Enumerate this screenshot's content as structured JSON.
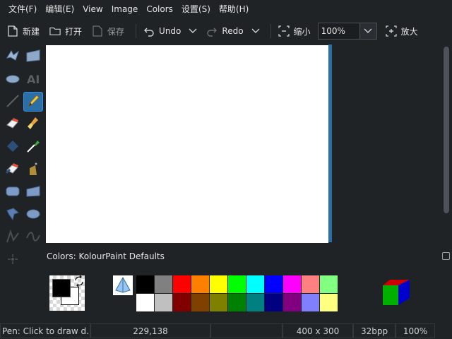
{
  "menu": [
    "文件(F)",
    "编辑(E)",
    "View",
    "Image",
    "Colors",
    "设置(S)",
    "帮助(H)"
  ],
  "toolbar": {
    "new_label": "新建",
    "open_label": "打开",
    "save_label": "保存",
    "undo_label": "Undo",
    "redo_label": "Redo",
    "zoom_out_label": "缩小",
    "zoom_value": "100%",
    "zoom_in_label": "放大"
  },
  "tools": [
    {
      "name": "free-form-select-tool",
      "icon": "lasso-icon",
      "active": false
    },
    {
      "name": "rectangular-select-tool",
      "icon": "rect-select-icon",
      "active": false
    },
    {
      "name": "elliptical-select-tool",
      "icon": "ellipse-select-icon",
      "active": false
    },
    {
      "name": "text-tool",
      "icon": "text-icon",
      "active": false
    },
    {
      "name": "line-tool",
      "icon": "line-icon",
      "active": false
    },
    {
      "name": "pen-tool",
      "icon": "pencil-icon",
      "active": true
    },
    {
      "name": "eraser-tool",
      "icon": "eraser-icon",
      "active": false
    },
    {
      "name": "brush-tool",
      "icon": "brush-icon",
      "active": false
    },
    {
      "name": "flood-fill-tool",
      "icon": "paint-bucket-icon",
      "active": false
    },
    {
      "name": "color-picker-tool",
      "icon": "eyedropper-icon",
      "active": false
    },
    {
      "name": "color-eraser-tool",
      "icon": "color-eraser-icon",
      "active": false
    },
    {
      "name": "spraycan-tool",
      "icon": "spraycan-icon",
      "active": false
    },
    {
      "name": "rounded-rectangle-tool",
      "icon": "rounded-rect-icon",
      "active": false
    },
    {
      "name": "rectangle-tool",
      "icon": "rectangle-icon",
      "active": false
    },
    {
      "name": "polygon-tool",
      "icon": "polygon-icon",
      "active": false
    },
    {
      "name": "ellipse-tool",
      "icon": "ellipse-icon",
      "active": false
    },
    {
      "name": "connected-lines-tool",
      "icon": "connected-lines-icon",
      "active": false
    },
    {
      "name": "curve-tool",
      "icon": "curve-icon",
      "active": false
    },
    {
      "name": "tool-option",
      "icon": "star-icon",
      "active": false
    }
  ],
  "colors_panel": {
    "title": "Colors: KolourPaint Defaults",
    "foreground": "#000000",
    "background": "#ffffff",
    "palette_top": [
      "#000000",
      "#808080",
      "#ff0000",
      "#ff8000",
      "#ffff00",
      "#00ff00",
      "#00ffff",
      "#0000ff",
      "#ff00ff",
      "#ff8080",
      "#80ff80"
    ],
    "palette_bottom": [
      "#ffffff",
      "#c0c0c0",
      "#800000",
      "#804000",
      "#808000",
      "#008000",
      "#008080",
      "#000080",
      "#800080",
      "#8080ff",
      "#ffff80"
    ]
  },
  "status": {
    "message": "Pen: Click to draw d…",
    "coordinates": "229,138",
    "selection": "",
    "image_size": "400 x 300",
    "depth": "32bpp",
    "zoom": "100%"
  },
  "theme": {
    "accent": "#2a6fa8",
    "window_bg": "#202326"
  }
}
